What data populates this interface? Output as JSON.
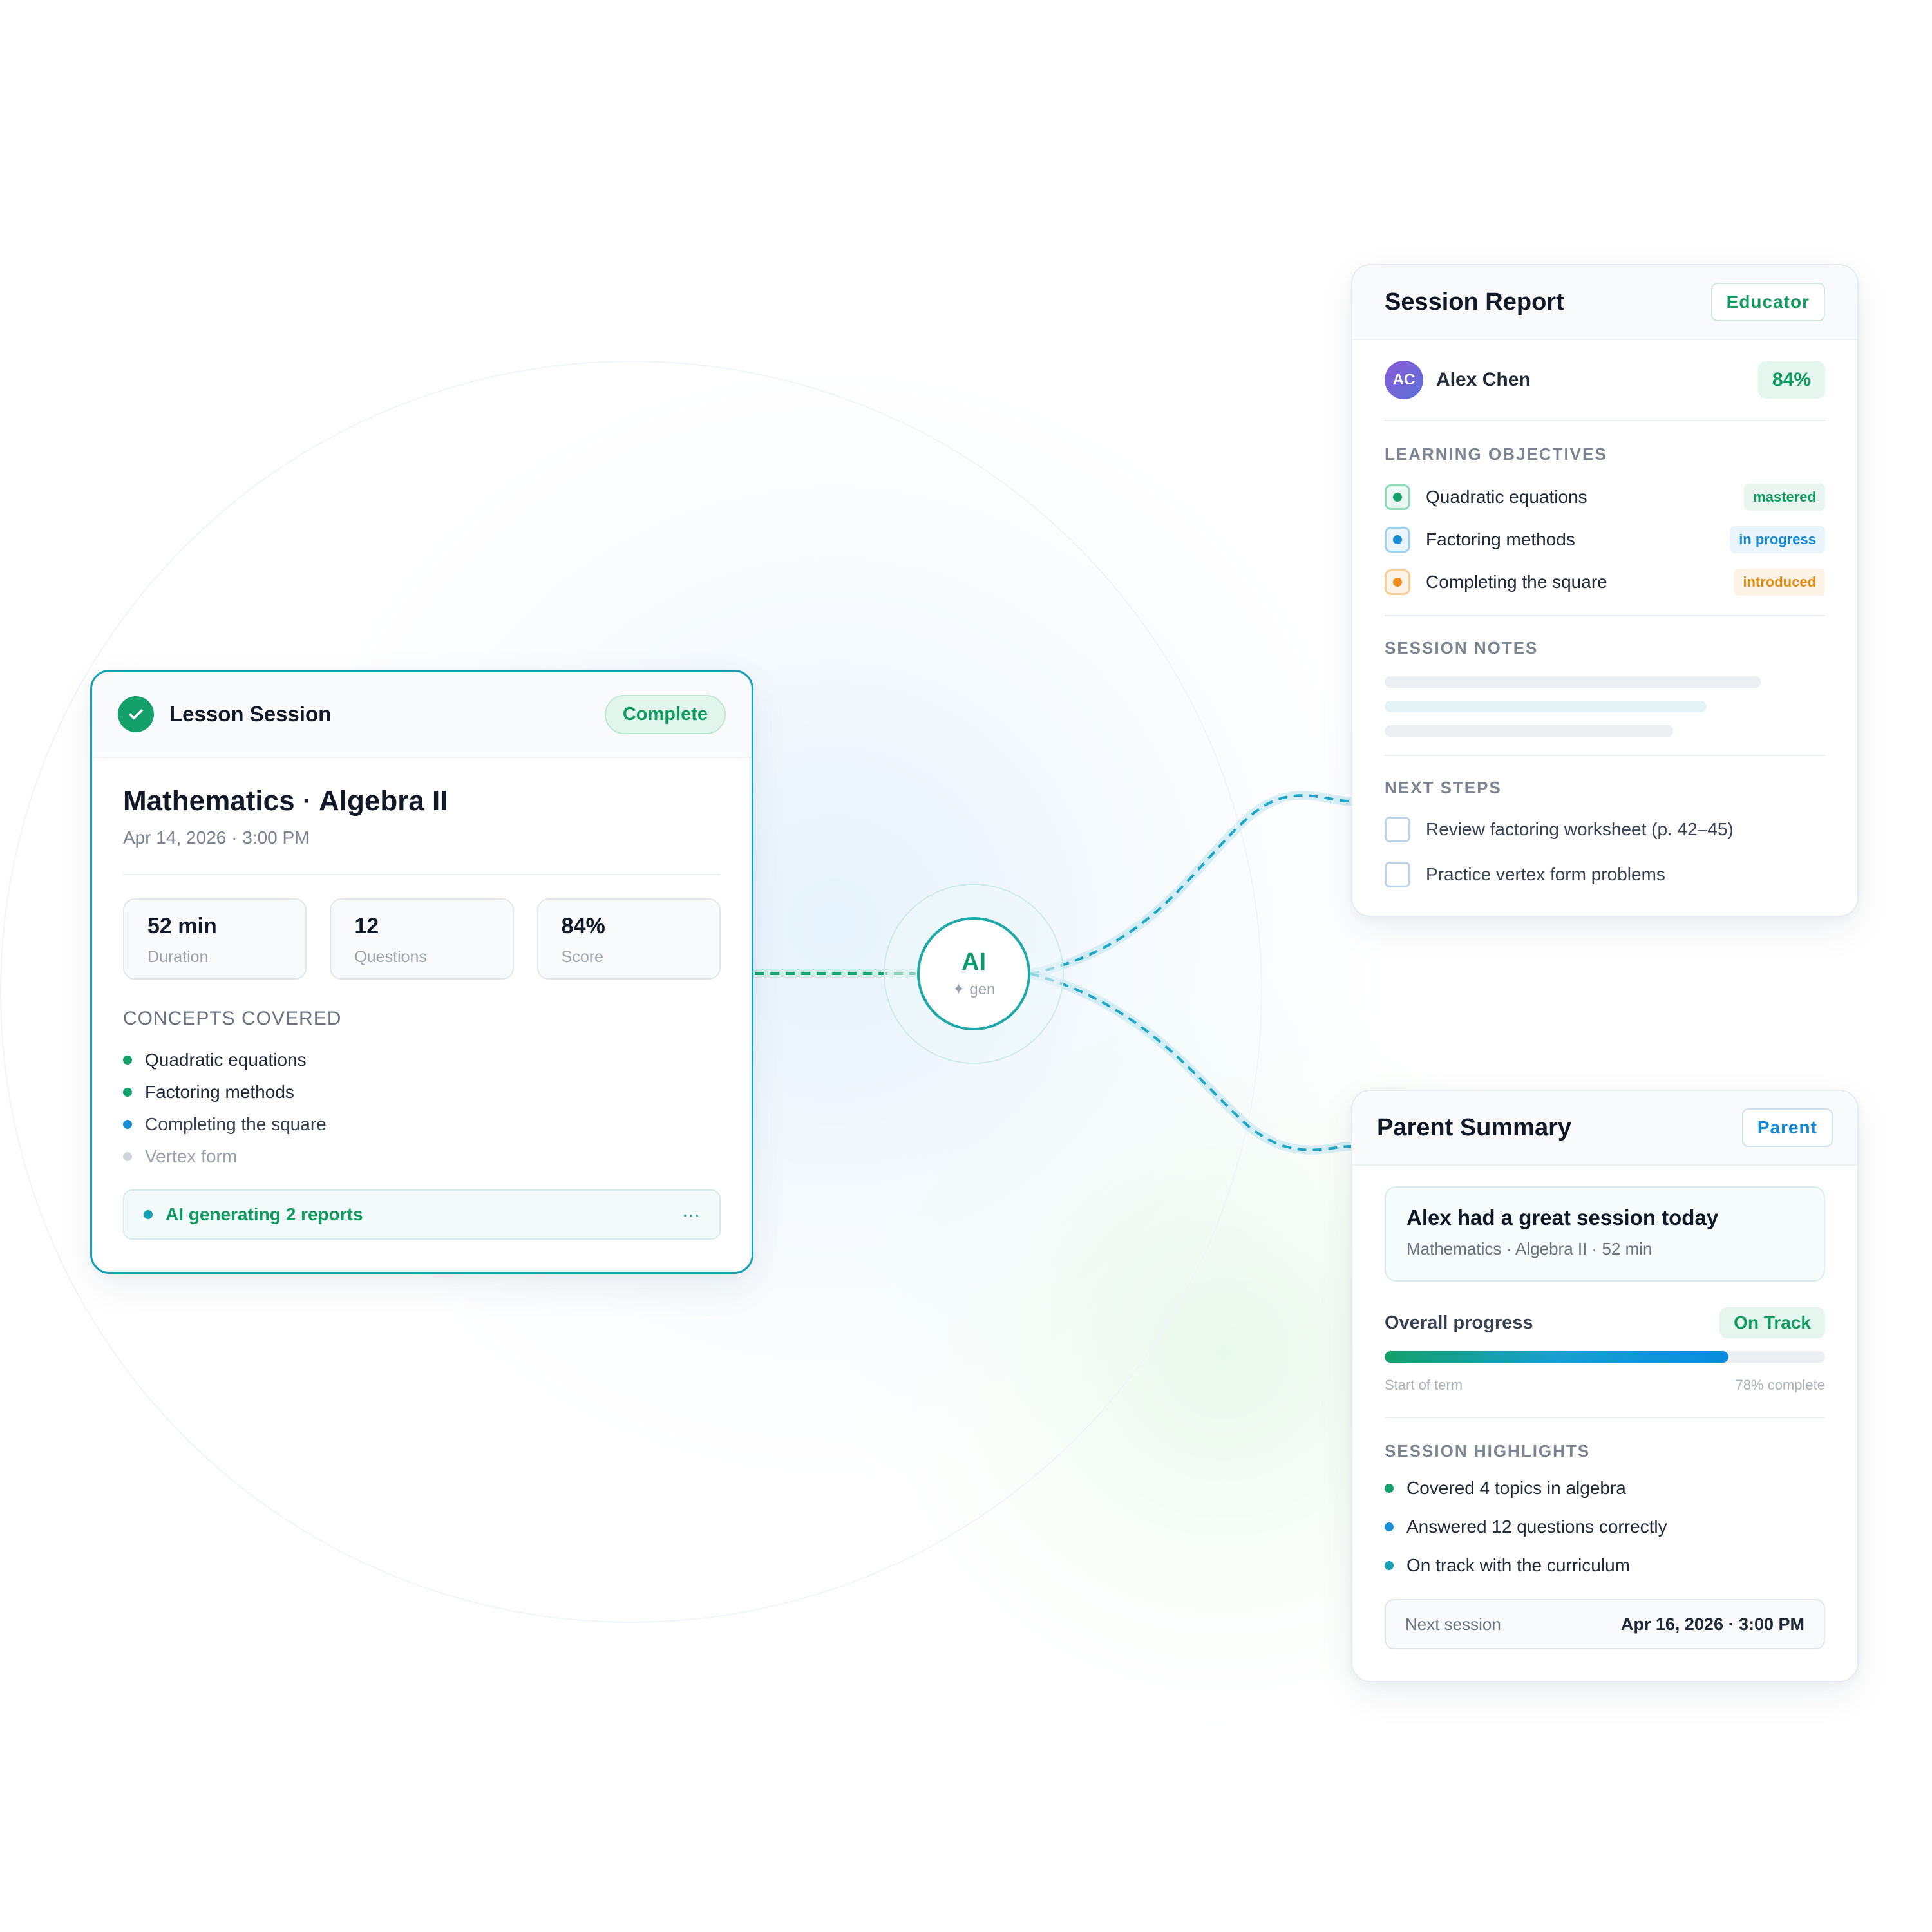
{
  "colors": {
    "accent_green": "#13a06a",
    "accent_teal": "#16a0b4",
    "accent_blue": "#1287d4",
    "accent_orange": "#f08a1c"
  },
  "lesson": {
    "title": "Lesson Session",
    "status": "Complete",
    "subject": "Mathematics · Algebra II",
    "datetime": "Apr 14, 2026 · 3:00 PM",
    "stats": [
      {
        "value": "52 min",
        "label": "Duration"
      },
      {
        "value": "12",
        "label": "Questions"
      },
      {
        "value": "84%",
        "label": "Score"
      }
    ],
    "concepts_label": "CONCEPTS COVERED",
    "concepts": [
      {
        "text": "Quadratic equations",
        "state": "done"
      },
      {
        "text": "Factoring methods",
        "state": "done"
      },
      {
        "text": "Completing the square",
        "state": "active"
      },
      {
        "text": "Vertex form",
        "state": "pending"
      }
    ],
    "ai_status": "AI generating 2 reports",
    "ai_dots": "···"
  },
  "ai_hub": {
    "label": "AI",
    "sub": "✦ gen"
  },
  "report": {
    "title": "Session Report",
    "audience": "Educator",
    "student": {
      "initials": "AC",
      "name": "Alex Chen",
      "score": "84%"
    },
    "objectives_label": "LEARNING OBJECTIVES",
    "objectives": [
      {
        "text": "Quadratic equations",
        "status": "mastered"
      },
      {
        "text": "Factoring methods",
        "status": "in progress"
      },
      {
        "text": "Completing the square",
        "status": "introduced"
      }
    ],
    "notes_label": "SESSION NOTES",
    "next_steps_label": "NEXT STEPS",
    "next_steps": [
      "Review factoring worksheet (p. 42–45)",
      "Practice vertex form problems"
    ]
  },
  "parent": {
    "title": "Parent Summary",
    "audience": "Parent",
    "headline": "Alex had a great session today",
    "headline_sub": "Mathematics · Algebra II · 52 min",
    "progress_label": "Overall progress",
    "progress_status": "On Track",
    "progress_value": 0.78,
    "progress_start": "Start of term",
    "progress_end": "78% complete",
    "highlights_label": "SESSION HIGHLIGHTS",
    "highlights": [
      "Covered 4 topics in algebra",
      "Answered 12 questions correctly",
      "On track with the curriculum"
    ],
    "next_session_label": "Next session",
    "next_session_value": "Apr 16, 2026 · 3:00 PM"
  }
}
